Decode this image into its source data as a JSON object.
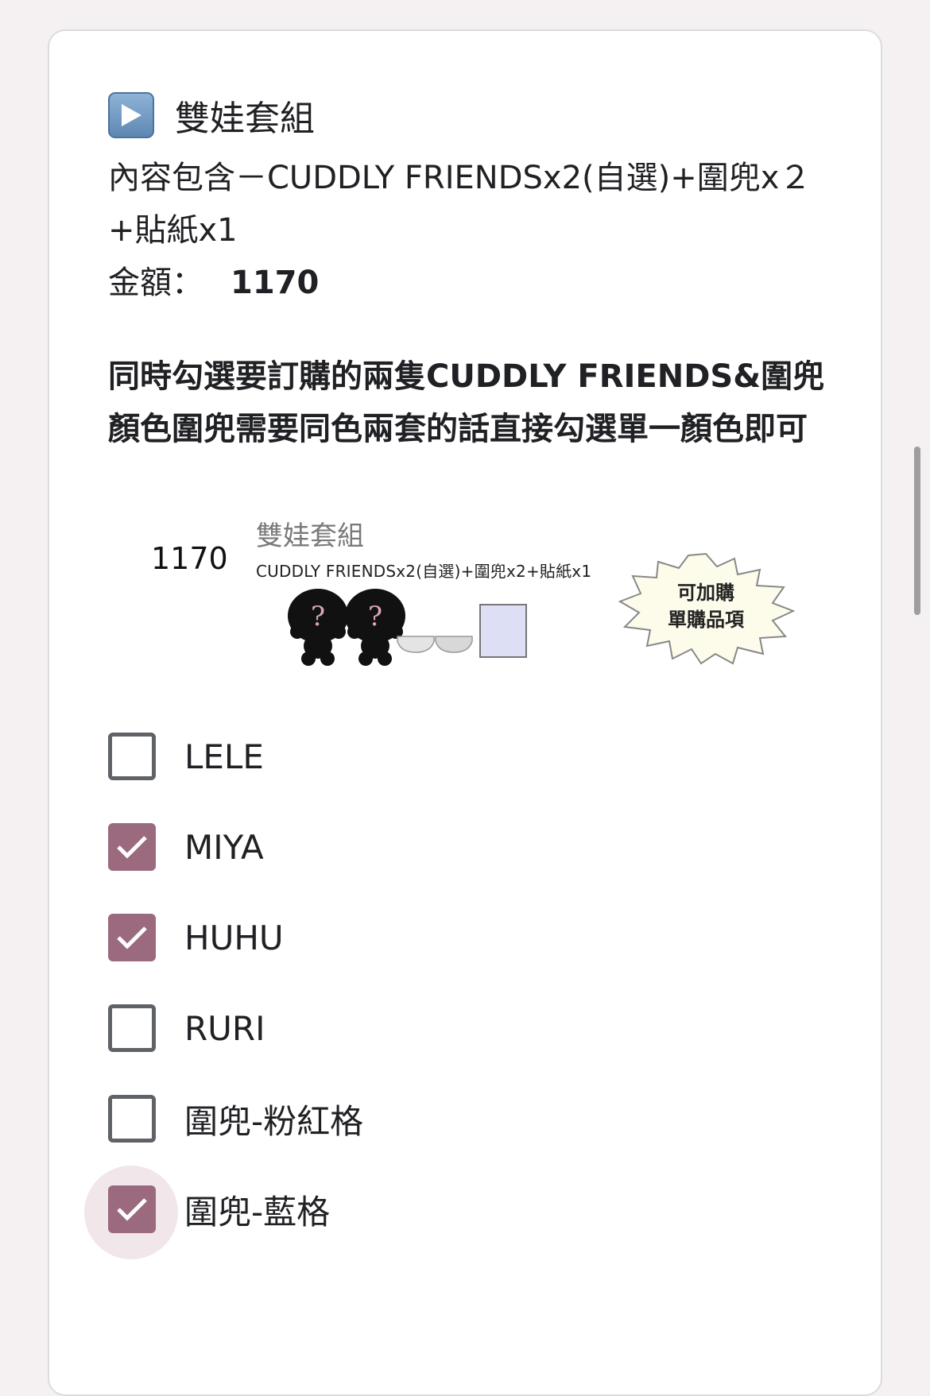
{
  "section": {
    "icon": "play-button-icon",
    "title": "雙娃套組",
    "description": "內容包含－CUDDLY FRIENDSx2(自選)+圍兜x２+貼紙x1",
    "price_label": "金額：",
    "price_value": "1170",
    "instruction": "同時勾選要訂購的兩隻CUDDLY FRIENDS&圍兜顏色圍兜需要同色兩套的話直接勾選單一顏色即可"
  },
  "product_image": {
    "price": "1170",
    "title": "雙娃套組",
    "contents": "CUDDLY FRIENDSx2(自選)+圍兜x2+貼紙x1",
    "badge_line1": "可加購",
    "badge_line2": "單購品項"
  },
  "options": [
    {
      "label": "LELE",
      "checked": false
    },
    {
      "label": "MIYA",
      "checked": true
    },
    {
      "label": "HUHU",
      "checked": true
    },
    {
      "label": "RURI",
      "checked": false
    },
    {
      "label": "圍兜-粉紅格",
      "checked": false
    },
    {
      "label": "圍兜-藍格",
      "checked": true
    }
  ],
  "colors": {
    "checkbox_checked": "#9b6a7f",
    "checkbox_unchecked_border": "#5f6368",
    "page_background": "#f5f0f1",
    "focus_halo": "#f1e6ea"
  }
}
